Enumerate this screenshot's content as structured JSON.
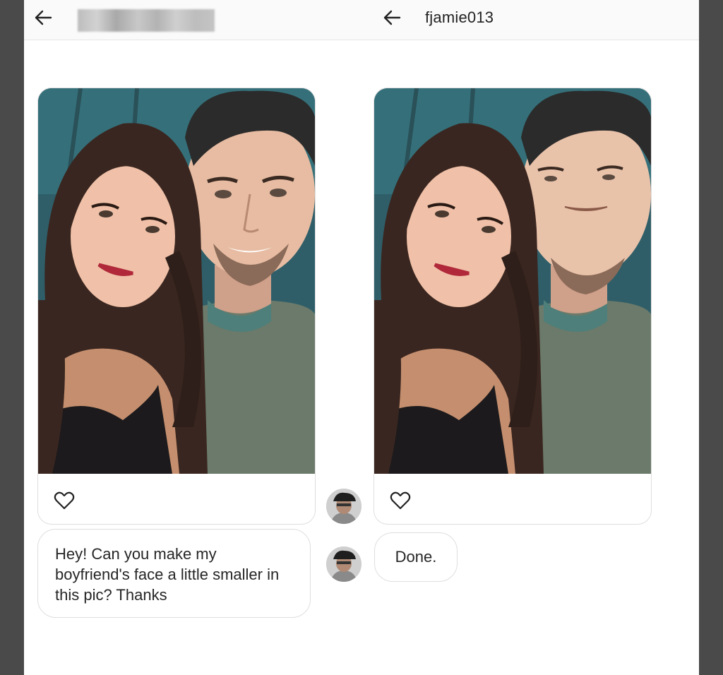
{
  "left_screen": {
    "back_icon": "arrow-left-icon",
    "message_text": "Hey! Can you make my boyfriend's face a little smaller in this pic? Thanks"
  },
  "right_screen": {
    "back_icon": "arrow-left-icon",
    "title": "fjamie013",
    "reply_text": "Done."
  },
  "icons": {
    "like": "heart-icon",
    "avatar": "user-avatar"
  },
  "colors": {
    "background": "#4a4a4a",
    "screen": "#ffffff",
    "border": "#dedede",
    "text": "#262626"
  }
}
